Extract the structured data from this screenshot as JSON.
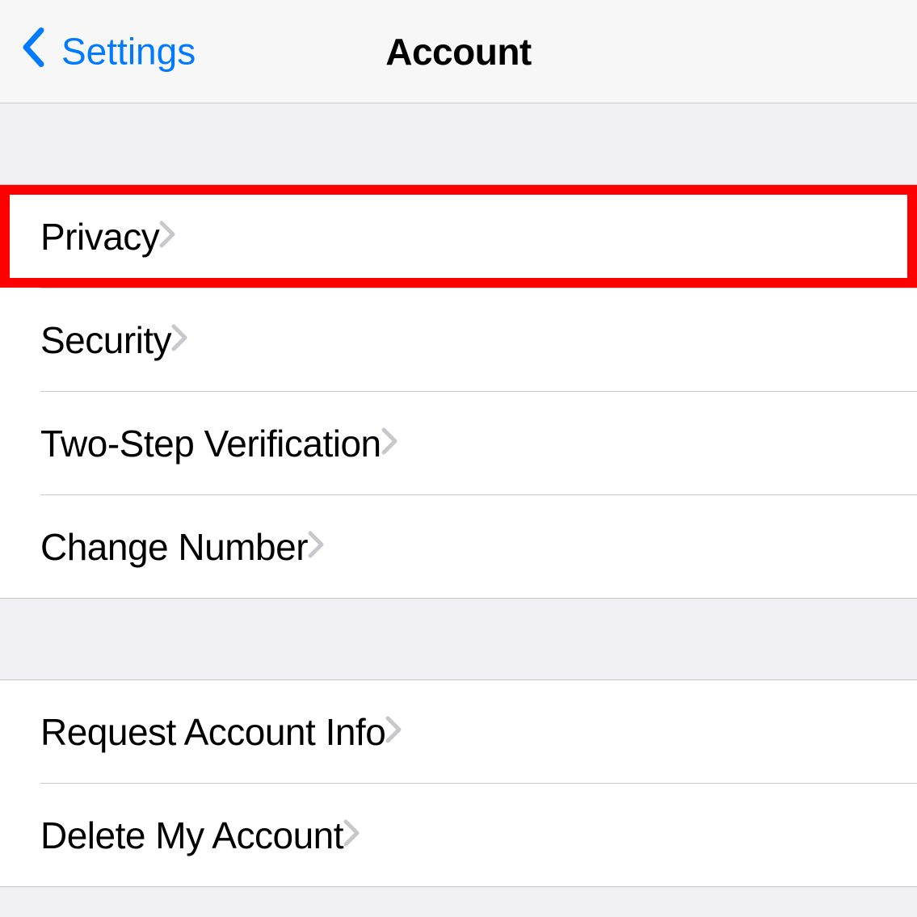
{
  "nav": {
    "back_label": "Settings",
    "title": "Account"
  },
  "sections": [
    {
      "items": [
        {
          "label": "Privacy",
          "highlighted": true
        },
        {
          "label": "Security"
        },
        {
          "label": "Two-Step Verification"
        },
        {
          "label": "Change Number"
        }
      ]
    },
    {
      "items": [
        {
          "label": "Request Account Info"
        },
        {
          "label": "Delete My Account"
        }
      ]
    }
  ]
}
